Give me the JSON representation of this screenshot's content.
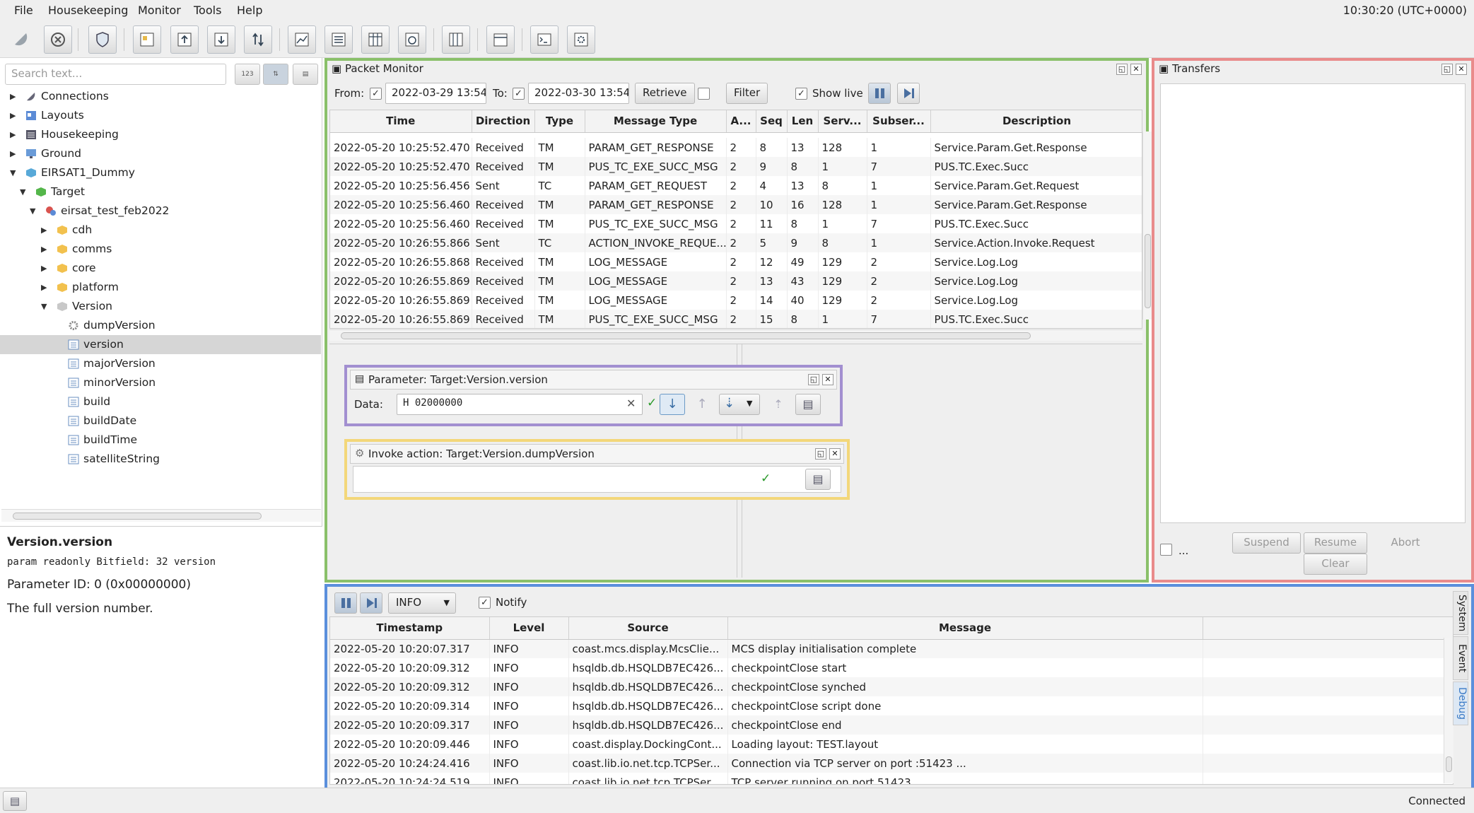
{
  "menu": {
    "file": "File",
    "housekeeping": "Housekeeping",
    "monitor": "Monitor",
    "tools": "Tools",
    "help": "Help"
  },
  "clock": "10:30:20 (UTC+0000)",
  "left": {
    "search_placeholder": "Search text...",
    "sort_numeric": "123",
    "tree": [
      {
        "label": "Connections"
      },
      {
        "label": "Layouts"
      },
      {
        "label": "Housekeeping"
      },
      {
        "label": "Ground"
      },
      {
        "label": "EIRSAT1_Dummy"
      },
      {
        "label": "Target"
      },
      {
        "label": "eirsat_test_feb2022"
      },
      {
        "label": "cdh"
      },
      {
        "label": "comms"
      },
      {
        "label": "core"
      },
      {
        "label": "platform"
      },
      {
        "label": "Version"
      },
      {
        "label": "dumpVersion"
      },
      {
        "label": "version"
      },
      {
        "label": "majorVersion"
      },
      {
        "label": "minorVersion"
      },
      {
        "label": "build"
      },
      {
        "label": "buildDate"
      },
      {
        "label": "buildTime"
      },
      {
        "label": "satelliteString"
      }
    ],
    "info_title": "Version.version",
    "info_type": "param readonly Bitfield: 32 version",
    "info_id": "Parameter ID: 0 (0x00000000)",
    "info_desc": "The full version number."
  },
  "packet_monitor": {
    "title": "Packet Monitor",
    "from_label": "From:",
    "from_value": "2022-03-29 13:54",
    "to_label": "To:",
    "to_value": "2022-03-30 13:54",
    "retrieve": "Retrieve",
    "filter": "Filter",
    "show_live": "Show live",
    "columns": [
      "Time",
      "Direction",
      "Type",
      "Message Type",
      "A...",
      "Seq",
      "Len",
      "Serv...",
      "Subser...",
      "Description"
    ],
    "rows": [
      [
        "2022-05-20 10:25:52.470",
        "Received",
        "TM",
        "PARAM_GET_RESPONSE",
        "2",
        "8",
        "13",
        "128",
        "1",
        "Service.Param.Get.Response"
      ],
      [
        "2022-05-20 10:25:52.470",
        "Received",
        "TM",
        "PUS_TC_EXE_SUCC_MSG",
        "2",
        "9",
        "8",
        "1",
        "7",
        "PUS.TC.Exec.Succ"
      ],
      [
        "2022-05-20 10:25:56.456",
        "Sent",
        "TC",
        "PARAM_GET_REQUEST",
        "2",
        "4",
        "13",
        "8",
        "1",
        "Service.Param.Get.Request"
      ],
      [
        "2022-05-20 10:25:56.460",
        "Received",
        "TM",
        "PARAM_GET_RESPONSE",
        "2",
        "10",
        "16",
        "128",
        "1",
        "Service.Param.Get.Response"
      ],
      [
        "2022-05-20 10:25:56.460",
        "Received",
        "TM",
        "PUS_TC_EXE_SUCC_MSG",
        "2",
        "11",
        "8",
        "1",
        "7",
        "PUS.TC.Exec.Succ"
      ],
      [
        "2022-05-20 10:26:55.866",
        "Sent",
        "TC",
        "ACTION_INVOKE_REQUE...",
        "2",
        "5",
        "9",
        "8",
        "1",
        "Service.Action.Invoke.Request"
      ],
      [
        "2022-05-20 10:26:55.868",
        "Received",
        "TM",
        "LOG_MESSAGE",
        "2",
        "12",
        "49",
        "129",
        "2",
        "Service.Log.Log"
      ],
      [
        "2022-05-20 10:26:55.869",
        "Received",
        "TM",
        "LOG_MESSAGE",
        "2",
        "13",
        "43",
        "129",
        "2",
        "Service.Log.Log"
      ],
      [
        "2022-05-20 10:26:55.869",
        "Received",
        "TM",
        "LOG_MESSAGE",
        "2",
        "14",
        "40",
        "129",
        "2",
        "Service.Log.Log"
      ],
      [
        "2022-05-20 10:26:55.869",
        "Received",
        "TM",
        "PUS_TC_EXE_SUCC_MSG",
        "2",
        "15",
        "8",
        "1",
        "7",
        "PUS.TC.Exec.Succ"
      ]
    ]
  },
  "param_panel": {
    "title": "Parameter: Target:Version.version",
    "data_label": "Data:",
    "data_value": "H 02000000"
  },
  "action_panel": {
    "title": "Invoke action: Target:Version.dumpVersion"
  },
  "transfers": {
    "title": "Transfers",
    "suspend": "Suspend",
    "resume": "Resume",
    "abort": "Abort",
    "clear": "Clear",
    "more": "..."
  },
  "log": {
    "level": "INFO",
    "notify": "Notify",
    "columns": [
      "Timestamp",
      "Level",
      "Source",
      "Message"
    ],
    "rows": [
      [
        "2022-05-20 10:20:07.317",
        "INFO",
        "coast.mcs.display.McsClie...",
        "MCS display initialisation complete"
      ],
      [
        "2022-05-20 10:20:09.312",
        "INFO",
        "hsqldb.db.HSQLDB7EC426...",
        "checkpointClose start"
      ],
      [
        "2022-05-20 10:20:09.312",
        "INFO",
        "hsqldb.db.HSQLDB7EC426...",
        "checkpointClose synched"
      ],
      [
        "2022-05-20 10:20:09.314",
        "INFO",
        "hsqldb.db.HSQLDB7EC426...",
        "checkpointClose script done"
      ],
      [
        "2022-05-20 10:20:09.317",
        "INFO",
        "hsqldb.db.HSQLDB7EC426...",
        "checkpointClose end"
      ],
      [
        "2022-05-20 10:20:09.446",
        "INFO",
        "coast.display.DockingCont...",
        "Loading layout: TEST.layout"
      ],
      [
        "2022-05-20 10:24:24.416",
        "INFO",
        "coast.lib.io.net.tcp.TCPSer...",
        "Connection via TCP server on port :51423 ..."
      ],
      [
        "2022-05-20 10:24:24.519",
        "INFO",
        "coast.lib.io.net.tcp.TCPSer...",
        "TCP server running on port 51423"
      ]
    ],
    "tabs": {
      "system": "System",
      "event": "Event",
      "debug": "Debug"
    }
  },
  "status": {
    "connected": "Connected"
  },
  "colors": {
    "packet_monitor_border": "#8ac06a",
    "transfers_border": "#e98b8b",
    "log_border": "#5b8fdc",
    "param_border": "#a28fd0",
    "action_border": "#f3d77a"
  }
}
